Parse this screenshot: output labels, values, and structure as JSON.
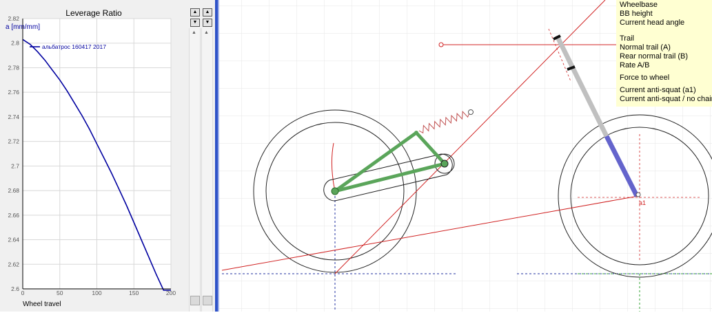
{
  "chart": {
    "title": "Leverage Ratio",
    "y_axis_label": "a [mm/mm]",
    "x_axis_label": "Wheel travel",
    "legend_label": "альбатрос 160417 2017"
  },
  "chart_data": {
    "type": "line",
    "title": "Leverage Ratio",
    "xlabel": "Wheel travel",
    "ylabel": "a [mm/mm]",
    "xlim": [
      0,
      200
    ],
    "ylim": [
      2.6,
      2.82
    ],
    "x_ticks": [
      0,
      50,
      100,
      150,
      200
    ],
    "y_ticks": [
      2.6,
      2.62,
      2.64,
      2.66,
      2.68,
      2.7,
      2.72,
      2.74,
      2.76,
      2.78,
      2.8,
      2.82
    ],
    "grid": true,
    "legend_position": "top-left",
    "series": [
      {
        "name": "альбатрос 160417 2017",
        "color": "#0000a0",
        "x": [
          0,
          10,
          20,
          30,
          40,
          50,
          60,
          70,
          80,
          90,
          100,
          110,
          120,
          130,
          140,
          150,
          160,
          170,
          180,
          190,
          200
        ],
        "y": [
          2.803,
          2.799,
          2.793,
          2.786,
          2.778,
          2.77,
          2.761,
          2.751,
          2.741,
          2.73,
          2.718,
          2.706,
          2.694,
          2.681,
          2.668,
          2.654,
          2.64,
          2.626,
          2.612,
          2.598,
          2.584
        ]
      }
    ]
  },
  "info_panel": {
    "lines": [
      "Wheelbase",
      "BB height",
      "Current head angle",
      "Trail",
      "Normal trail (A)",
      "Rear normal trail (B)",
      "Rate A/B",
      "Force to wheel",
      "Current anti-squat (a1)",
      "Current anti-squat / no chain"
    ]
  },
  "drawing": {
    "point_label": "a1",
    "colors": {
      "frame": "#5aa55a",
      "fork_upper": "#c0c0c0",
      "fork_lower": "#6464cc",
      "construction_line": "#d02020",
      "ground_line": "#2030a0",
      "grid": "#e6e6e6"
    }
  },
  "colors": {
    "divider": "#2e52c8",
    "info_background": "#ffffd2"
  }
}
